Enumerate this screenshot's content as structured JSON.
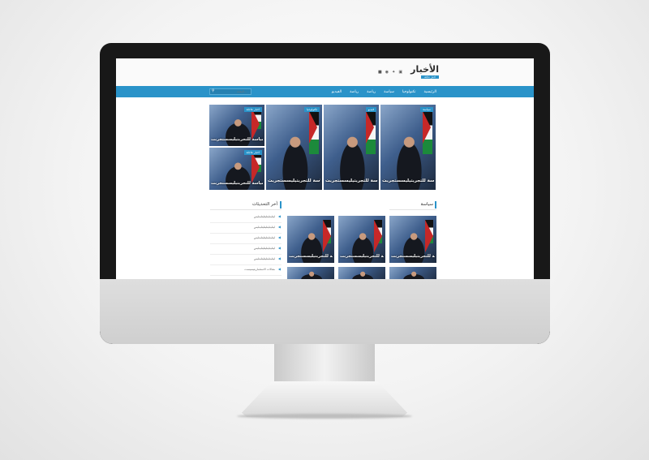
{
  "site": {
    "logo_title": "الأخبار",
    "logo_subtitle": "اخبار عاجلة",
    "social_icons": [
      "facebook-icon",
      "twitter-icon",
      "instagram-icon",
      "user-icon"
    ],
    "accent_color": "#2a93c9"
  },
  "nav": {
    "items": [
      "الرئيسية",
      "تكنولوجيا",
      "سياسة",
      "رياضة",
      "رياضة",
      "الفيديو"
    ],
    "search_placeholder": "البحث..."
  },
  "featured": [
    {
      "badge": "سياسة",
      "title": "سياسة للتجربتيليسستجربت"
    },
    {
      "badge": "فيديو",
      "title": "سياسة للتجربتيليسستجربت"
    },
    {
      "badge": "تكنولوجيا",
      "title": "سياسة للتجربتيليسستجربت"
    },
    {
      "badge": "اخبار عاجلة",
      "title": "سياسة للتجربتيليسستجربت"
    },
    {
      "badge": "اخبار عاجلة",
      "title": "سياسة للتجربتيليسستجربت"
    }
  ],
  "politics": {
    "heading": "سياسة",
    "cards": [
      {
        "title": "سياسة للتجربتيليسستجربت"
      },
      {
        "title": "سياسة للتجربتيليسستجربت"
      },
      {
        "title": "سياسة للتجربتيليسستجربت"
      }
    ]
  },
  "latest": {
    "heading": "آخر التحديثات",
    "items": [
      "ليتليتليتليتليتليتليس",
      "ليتليتليتليتليتليتليس",
      "ليتليتليتليتليتليتليس",
      "ليتليتليتليتليتليتليس",
      "ليتليتليتليتليتليتليس",
      "مقالات الاستثماريتيسيست"
    ]
  }
}
